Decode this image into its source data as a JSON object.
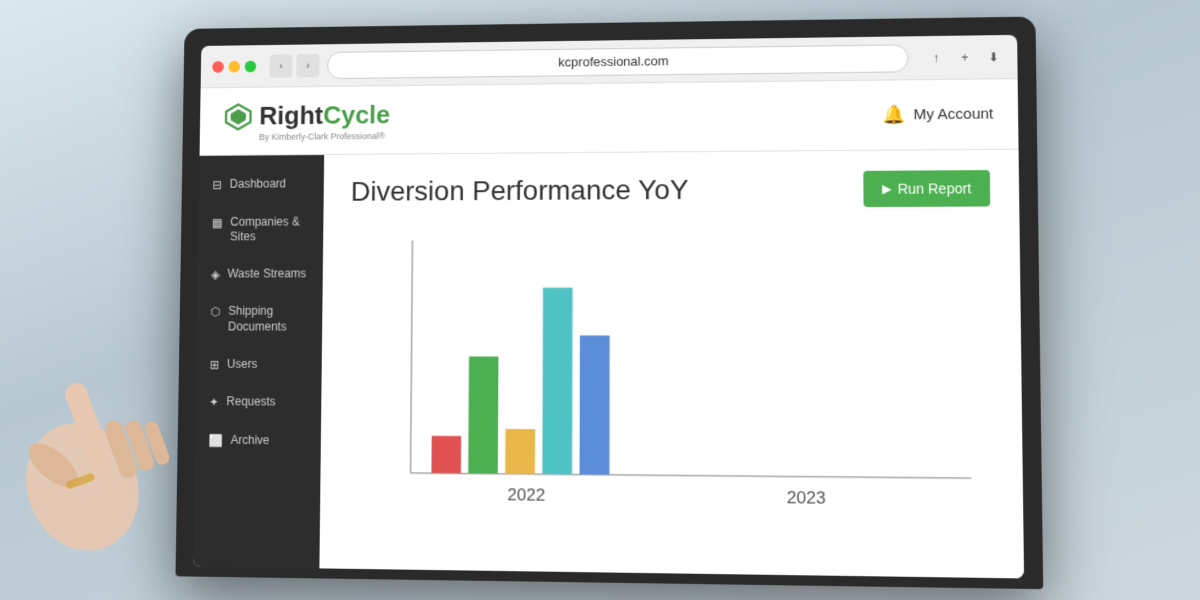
{
  "browser": {
    "url": "kcprofessional.com",
    "nav_back": "‹",
    "nav_forward": "›",
    "window_icon": "⊞"
  },
  "header": {
    "logo_text_prefix": "Right",
    "logo_text_suffix": "Cycle",
    "logo_subtitle": "By Kimberly-Clark Professional®",
    "my_account_label": "My Account",
    "bell_icon": "🔔"
  },
  "sidebar": {
    "items": [
      {
        "id": "dashboard",
        "label": "Dashboard",
        "icon": "⊟"
      },
      {
        "id": "companies-sites",
        "label": "Companies & Sites",
        "icon": "▦"
      },
      {
        "id": "waste-streams",
        "label": "Waste Streams",
        "icon": "◈"
      },
      {
        "id": "shipping-documents",
        "label": "Shipping Documents",
        "icon": "⬡"
      },
      {
        "id": "users",
        "label": "Users",
        "icon": "⊞"
      },
      {
        "id": "requests",
        "label": "Requests",
        "icon": "✦"
      },
      {
        "id": "archive",
        "label": "Archive",
        "icon": "⬜"
      }
    ]
  },
  "dashboard": {
    "title": "Diversion Performance YoY",
    "run_report_label": "Run Report",
    "play_icon": "▶"
  },
  "chart": {
    "x_labels": [
      "2022",
      "2023"
    ],
    "bars_2022": [
      {
        "color": "#e05252",
        "height": 35,
        "label": "red"
      },
      {
        "color": "#4caf50",
        "height": 110,
        "label": "green"
      },
      {
        "color": "#e8b84b",
        "height": 42,
        "label": "yellow"
      },
      {
        "color": "#4fc3c3",
        "height": 175,
        "label": "teal"
      },
      {
        "color": "#5b8dd9",
        "height": 130,
        "label": "blue"
      }
    ]
  },
  "colors": {
    "sidebar_bg": "#2d2d2d",
    "header_bg": "#ffffff",
    "accent_green": "#4caf50",
    "logo_green": "#4a9e4a"
  }
}
